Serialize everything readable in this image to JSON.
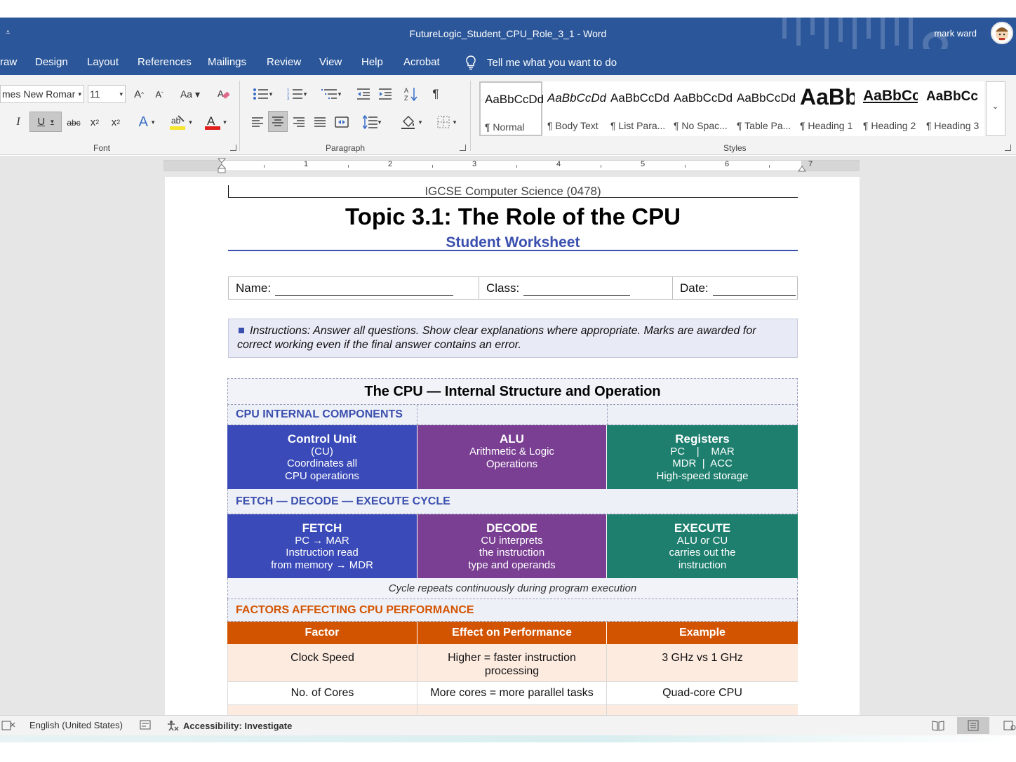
{
  "window": {
    "title": "FutureLogic_Student_CPU_Role_3_1  -  Word",
    "user": "mark ward"
  },
  "tabs": [
    "raw",
    "Design",
    "Layout",
    "References",
    "Mailings",
    "Review",
    "View",
    "Help",
    "Acrobat"
  ],
  "tell_me": "Tell me what you want to do",
  "ribbon": {
    "font_name": "mes New Romar",
    "font_size": "11",
    "font_group": "Font",
    "paragraph_group": "Paragraph",
    "styles_group": "Styles",
    "styles": [
      {
        "preview": "AaBbCcDd",
        "name": "¶ Normal"
      },
      {
        "preview": "AaBbCcDd",
        "name": "¶ Body Text"
      },
      {
        "preview": "AaBbCcDd",
        "name": "¶ List Para..."
      },
      {
        "preview": "AaBbCcDd",
        "name": "¶ No Spac..."
      },
      {
        "preview": "AaBbCcDd",
        "name": "¶ Table Pa..."
      },
      {
        "preview": "AaBb",
        "name": "¶ Heading 1"
      },
      {
        "preview": "AaBbCc",
        "name": "¶ Heading 2"
      },
      {
        "preview": "AaBbCc",
        "name": "¶ Heading 3"
      }
    ],
    "accent_colors": {
      "highlight": "#f5e52b",
      "font_color": "#e01f1f"
    }
  },
  "ruler": [
    "1",
    "2",
    "3",
    "4",
    "5",
    "6",
    "7"
  ],
  "doc": {
    "header": "IGCSE Computer Science (0478)",
    "title": "Topic 3.1: The Role of the CPU",
    "subtitle": "Student Worksheet",
    "fields": {
      "name": "Name:",
      "class": "Class:",
      "date": "Date:"
    },
    "instructions": "Instructions: Answer all questions. Show clear explanations where appropriate. Marks are awarded for correct working even if the final answer contains an error.",
    "table": {
      "title": "The CPU — Internal Structure and Operation",
      "components_heading": "CPU INTERNAL COMPONENTS",
      "components": [
        {
          "title": "Control Unit",
          "lines": [
            "(CU)",
            "Coordinates all",
            "CPU operations"
          ]
        },
        {
          "title": "ALU",
          "lines": [
            "Arithmetic & Logic",
            "Operations"
          ]
        },
        {
          "title": "Registers",
          "lines": [
            "PC    |    MAR",
            "MDR  |  ACC",
            "High-speed storage"
          ]
        }
      ],
      "cycle_heading": "FETCH — DECODE — EXECUTE CYCLE",
      "cycle": [
        {
          "title": "FETCH",
          "lines": [
            "PC → MAR",
            "Instruction read",
            "from memory → MDR"
          ]
        },
        {
          "title": "DECODE",
          "lines": [
            "CU interprets",
            "the instruction",
            "type and operands"
          ]
        },
        {
          "title": "EXECUTE",
          "lines": [
            "ALU or CU",
            "carries out the",
            "instruction"
          ]
        }
      ],
      "cycle_note": "Cycle repeats continuously during program execution",
      "factors_heading": "FACTORS AFFECTING CPU PERFORMANCE",
      "factor_headers": [
        "Factor",
        "Effect on Performance",
        "Example"
      ],
      "factor_rows": [
        [
          "Clock Speed",
          "Higher = faster instruction processing",
          "3 GHz vs 1 GHz"
        ],
        [
          "No. of Cores",
          "More cores = more parallel tasks",
          "Quad-core CPU"
        ]
      ]
    }
  },
  "status": {
    "language": "English (United States)",
    "accessibility": "Accessibility: Investigate"
  }
}
